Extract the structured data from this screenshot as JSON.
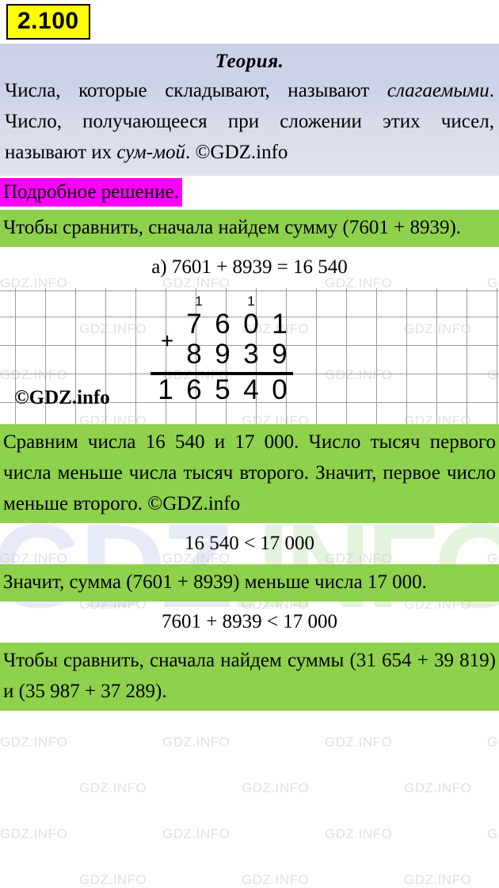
{
  "badge": {
    "number": "2.100"
  },
  "theory": {
    "title": "Теория.",
    "line1": "Числа, которые складывают, называют",
    "italic1": "слагаемыми",
    "line2": ". Число, получающееся при",
    "line3": "сложении этих чисел, называют их ",
    "italic2": "сум-",
    "italic3": "мой",
    "line4": ". ©GDZ.info",
    "full_text": "Числа, которые складывают, называют слагаемыми. Число, получающееся при сложении этих чисел, называют их суммой. ©GDZ.info"
  },
  "solution_label": {
    "text": "Подробное решение."
  },
  "step1": {
    "text": "Чтобы сравнить, сначала найдем сумму (7601 + 8939)."
  },
  "formula_a": {
    "text": "а) 7601 + 8939 = 16 540"
  },
  "column_addition": {
    "carries": [
      "1",
      "1"
    ],
    "operator": "+",
    "addend1": [
      "7",
      "6",
      "0",
      "1"
    ],
    "addend2": [
      "8",
      "9",
      "3",
      "9"
    ],
    "result": [
      "1",
      "6",
      "5",
      "4",
      "0"
    ],
    "watermark": "©GDZ.info"
  },
  "step2": {
    "text": "Сравним числа 16 540 и 17 000. Число тысяч первого числа меньше числа тысяч второго. Значит, первое число меньше второго. ©GDZ.info"
  },
  "formula_compare": {
    "text": "16 540 < 17 000"
  },
  "step3": {
    "text": "Значит, сумма (7601 + 8939) меньше числа 17 000."
  },
  "formula_conclusion": {
    "text": "7601 + 8939 < 17 000"
  },
  "step4": {
    "line1": "Чтобы сравнить, сначала найдем суммы",
    "line2": "(31 654 + 39 819) и (35 987 + 37 289)."
  },
  "watermarks": {
    "tile_text": "GDZ.INFO",
    "logo_part1": "GDZ",
    "logo_part2": ".INFO"
  },
  "colors": {
    "badge_bg": "#ffff00",
    "green_bg": "#8ed14c",
    "magenta_bg": "#ff00ff",
    "theory_bg": "#ccd0e6",
    "grid_line": "#9b9b9b"
  }
}
